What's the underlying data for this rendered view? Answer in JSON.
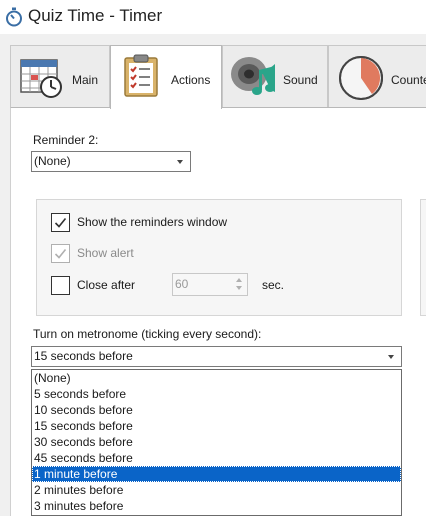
{
  "window": {
    "title": "Quiz Time - Timer"
  },
  "tabs": [
    {
      "label": "Main",
      "icon": "calendar-clock-icon",
      "active": false
    },
    {
      "label": "Actions",
      "icon": "clipboard-checklist-icon",
      "active": true
    },
    {
      "label": "Sound",
      "icon": "speaker-music-icon",
      "active": false
    },
    {
      "label": "Counter",
      "icon": "pie-timer-icon",
      "active": false
    }
  ],
  "reminder2": {
    "label": "Reminder 2:",
    "value": "(None)"
  },
  "options": {
    "show_reminders": {
      "label": "Show the reminders window",
      "checked": true
    },
    "show_alert": {
      "label": "Show alert",
      "checked": true,
      "disabled": true
    },
    "close_after": {
      "label": "Close after",
      "checked": false,
      "value": "60",
      "unit": "sec."
    }
  },
  "metronome": {
    "label": "Turn on metronome (ticking every second):",
    "value": "15 seconds before",
    "dropdown_options": [
      "(None)",
      "5 seconds before",
      "10 seconds before",
      "15 seconds before",
      "30 seconds before",
      "45 seconds before",
      "1 minute before",
      "2 minutes before",
      "3 minutes before"
    ],
    "highlighted_option": "1 minute before"
  },
  "colors": {
    "accent": "#0a64c8",
    "pie_fill": "#e07a5f",
    "music_note": "#2aa58a"
  }
}
